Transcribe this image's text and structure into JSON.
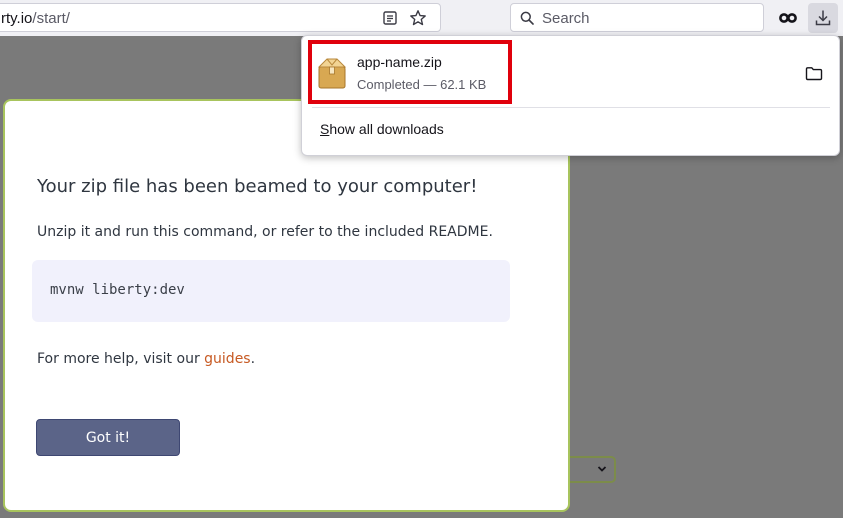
{
  "browser": {
    "url_host": "rty.io",
    "url_path": "/start/",
    "search_placeholder": "Search"
  },
  "downloads_panel": {
    "items": [
      {
        "file_name": "app-name.zip",
        "status": "Completed — 62.1 KB"
      }
    ],
    "show_all_accesskey": "S",
    "show_all_rest": "how all downloads"
  },
  "modal": {
    "heading": "Your zip file has been beamed to your computer!",
    "instruction": "Unzip it and run this command, or refer to the included README.",
    "command": "mvnw liberty:dev",
    "help_prefix": "For more help, visit our ",
    "help_link": "guides",
    "help_suffix": ".",
    "button_label": "Got it!"
  },
  "colors": {
    "highlight": "#e0000c",
    "modal_border": "#a8c45d",
    "link": "#c75a23",
    "button": "#5b6488"
  }
}
